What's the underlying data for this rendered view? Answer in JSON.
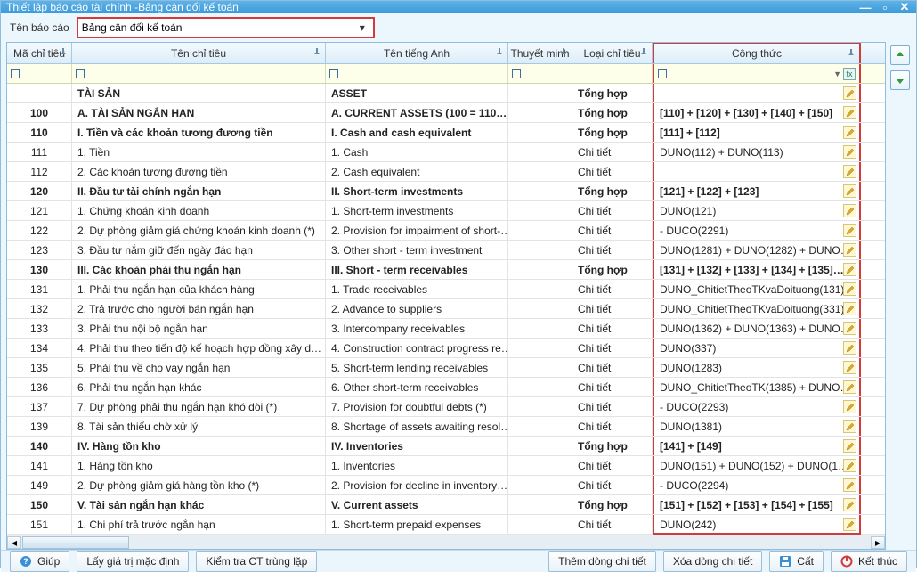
{
  "window": {
    "title": "Thiết lập báo cáo tài chính -Bảng cân đối kế toán"
  },
  "toolbar": {
    "report_name_label": "Tên báo cáo",
    "report_name_value": "Bảng cân đối kế toán"
  },
  "columns": {
    "ma": "Mã chỉ tiêu",
    "ten": "Tên chỉ tiêu",
    "en": "Tên tiếng Anh",
    "tm": "Thuyết minh",
    "loai": "Loại chỉ tiêu",
    "ct": "Công thức"
  },
  "loai": {
    "th": "Tổng hợp",
    "ct": "Chi tiết"
  },
  "rows": [
    {
      "bold": true,
      "ma": "",
      "ten": "TÀI SẢN",
      "en": "ASSET",
      "tm": "",
      "loai": "th",
      "ct": ""
    },
    {
      "bold": true,
      "ma": "100",
      "ten": "A. TÀI SẢN NGẮN HẠN",
      "en": "A. CURRENT ASSETS (100 = 110…",
      "tm": "",
      "loai": "th",
      "ct": "[110] + [120] + [130] + [140] + [150]"
    },
    {
      "bold": true,
      "ma": "110",
      "ten": "I. Tiền và các khoản tương đương tiền",
      "en": "I. Cash and cash equivalent",
      "tm": "",
      "loai": "th",
      "ct": "[111] + [112]"
    },
    {
      "bold": false,
      "ma": "111",
      "ten": "1. Tiền",
      "en": "1. Cash",
      "tm": "",
      "loai": "ct",
      "ct": "DUNO(112) + DUNO(113)"
    },
    {
      "bold": false,
      "ma": "112",
      "ten": "2. Các khoản tương đương tiền",
      "en": "2. Cash equivalent",
      "tm": "",
      "loai": "ct",
      "ct": ""
    },
    {
      "bold": true,
      "ma": "120",
      "ten": "II. Đầu tư tài chính ngắn hạn",
      "en": "II. Short-term investments",
      "tm": "",
      "loai": "th",
      "ct": "[121] + [122] + [123]"
    },
    {
      "bold": false,
      "ma": "121",
      "ten": "1. Chứng khoán kinh doanh",
      "en": "1. Short-term investments",
      "tm": "",
      "loai": "ct",
      "ct": "DUNO(121)"
    },
    {
      "bold": false,
      "ma": "122",
      "ten": "2. Dự phòng giảm giá chứng khoán kinh doanh (*)",
      "en": "2. Provision for impairment of short-…",
      "tm": "",
      "loai": "ct",
      "ct": " - DUCO(2291)"
    },
    {
      "bold": false,
      "ma": "123",
      "ten": "3. Đầu tư nắm giữ đến ngày đáo hạn",
      "en": "3. Other short - term investment",
      "tm": "",
      "loai": "ct",
      "ct": "DUNO(1281) + DUNO(1282) + DUNO…"
    },
    {
      "bold": true,
      "ma": "130",
      "ten": "III. Các khoản phải thu ngắn hạn",
      "en": "III. Short - term receivables",
      "tm": "",
      "loai": "th",
      "ct": "[131] + [132] + [133] + [134] + [135]…"
    },
    {
      "bold": false,
      "ma": "131",
      "ten": "1. Phải thu ngắn hạn của khách hàng",
      "en": "1. Trade receivables",
      "tm": "",
      "loai": "ct",
      "ct": "DUNO_ChitietTheoTKvaDoituong(131)"
    },
    {
      "bold": false,
      "ma": "132",
      "ten": "2. Trả trước cho người bán ngắn hạn",
      "en": "2. Advance to suppliers",
      "tm": "",
      "loai": "ct",
      "ct": "DUNO_ChitietTheoTKvaDoituong(331)"
    },
    {
      "bold": false,
      "ma": "133",
      "ten": "3. Phải thu nội bộ ngắn hạn",
      "en": "3. Intercompany receivables",
      "tm": "",
      "loai": "ct",
      "ct": "DUNO(1362) + DUNO(1363) + DUNO…"
    },
    {
      "bold": false,
      "ma": "134",
      "ten": "4. Phải thu theo tiến độ kế hoạch hợp đồng xây d…",
      "en": "4. Construction contract progress re…",
      "tm": "",
      "loai": "ct",
      "ct": "DUNO(337)"
    },
    {
      "bold": false,
      "ma": "135",
      "ten": "5. Phải thu về cho vay ngắn hạn",
      "en": "5. Short-term lending receivables",
      "tm": "",
      "loai": "ct",
      "ct": "DUNO(1283)"
    },
    {
      "bold": false,
      "ma": "136",
      "ten": "6. Phải thu ngắn hạn khác",
      "en": "6. Other short-term receivables",
      "tm": "",
      "loai": "ct",
      "ct": "DUNO_ChitietTheoTK(1385) + DUNO…"
    },
    {
      "bold": false,
      "ma": "137",
      "ten": "7. Dự phòng phải thu ngắn hạn khó đòi (*)",
      "en": "7. Provision for doubtful debts (*)",
      "tm": "",
      "loai": "ct",
      "ct": " - DUCO(2293)"
    },
    {
      "bold": false,
      "ma": "139",
      "ten": "8. Tài sản thiếu chờ xử lý",
      "en": "8. Shortage of assets awaiting resol…",
      "tm": "",
      "loai": "ct",
      "ct": "DUNO(1381)"
    },
    {
      "bold": true,
      "ma": "140",
      "ten": "IV. Hàng tồn kho",
      "en": "IV. Inventories",
      "tm": "",
      "loai": "th",
      "ct": "[141] + [149]"
    },
    {
      "bold": false,
      "ma": "141",
      "ten": "1. Hàng tồn kho",
      "en": "1. Inventories",
      "tm": "",
      "loai": "ct",
      "ct": "DUNO(151) + DUNO(152) + DUNO(1…"
    },
    {
      "bold": false,
      "ma": "149",
      "ten": "2. Dự phòng giảm giá hàng tồn kho (*)",
      "en": "2. Provision for decline in inventory…",
      "tm": "",
      "loai": "ct",
      "ct": " - DUCO(2294)"
    },
    {
      "bold": true,
      "ma": "150",
      "ten": "V. Tài sản ngắn hạn khác",
      "en": "V. Current assets",
      "tm": "",
      "loai": "th",
      "ct": "[151] + [152] + [153] + [154] + [155]"
    },
    {
      "bold": false,
      "ma": "151",
      "ten": "1. Chi phí trả trước ngắn hạn",
      "en": "1. Short-term prepaid expenses",
      "tm": "",
      "loai": "ct",
      "ct": "DUNO(242)"
    }
  ],
  "footer": {
    "help": "Giúp",
    "default": "Lấy giá trị mặc định",
    "check": "Kiểm tra CT trùng lặp",
    "add": "Thêm dòng chi tiết",
    "del": "Xóa dòng chi tiết",
    "save": "Cất",
    "close": "Kết thúc"
  }
}
